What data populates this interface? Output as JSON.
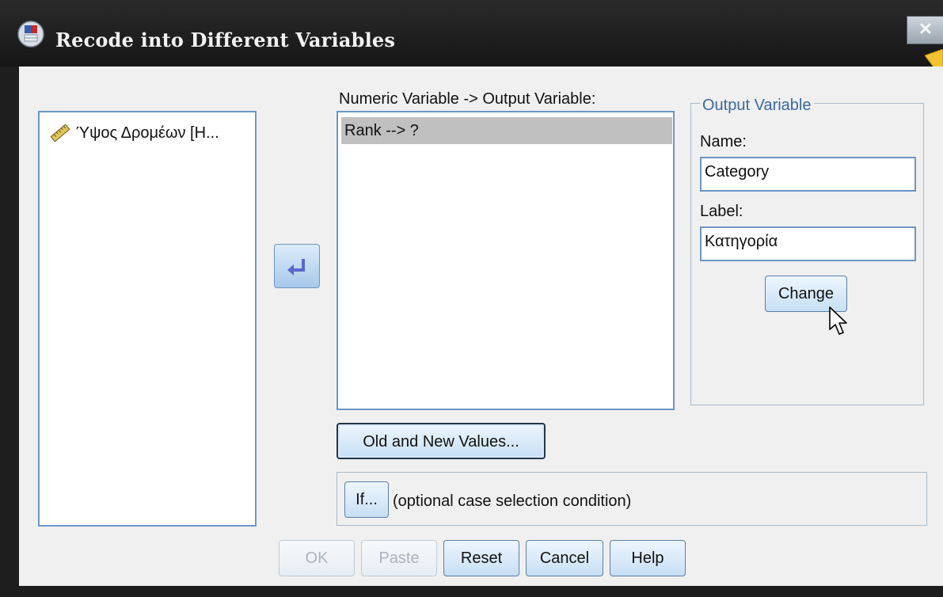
{
  "window": {
    "title": "Recode into Different Variables",
    "close_symbol": "✕"
  },
  "source_list": {
    "items": [
      {
        "label": "Ύψος Δρομέων [Η...",
        "icon": "ruler-icon"
      }
    ]
  },
  "move_button": {
    "icon": "back-arrow-icon"
  },
  "numeric_variable": {
    "label": "Numeric Variable -> Output Variable:",
    "items": [
      {
        "text": "Rank --> ?",
        "selected": true
      }
    ]
  },
  "output_variable": {
    "legend": "Output Variable",
    "name_label": "Name:",
    "name_value": "Category",
    "label_label": "Label:",
    "label_value": "Κατηγορία",
    "change_button": "Change"
  },
  "old_new_button": "Old and New Values...",
  "if_section": {
    "button": "If...",
    "text": "(optional case selection condition)"
  },
  "footer": {
    "ok": "OK",
    "paste": "Paste",
    "reset": "Reset",
    "cancel": "Cancel",
    "help": "Help"
  },
  "colors": {
    "accent": "#6c97c6",
    "title_bar": "#1e1e1e",
    "legend": "#3a68a0"
  }
}
